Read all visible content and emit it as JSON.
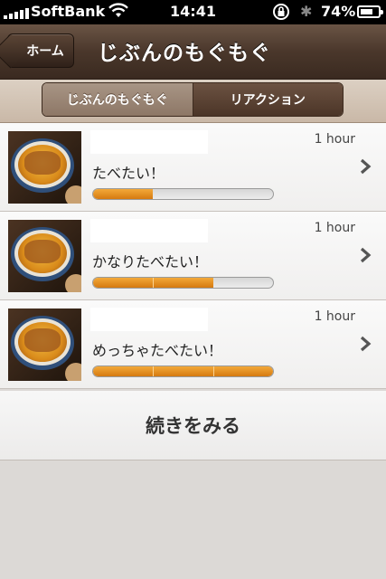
{
  "status_bar": {
    "carrier": "SoftBank",
    "time": "14:41",
    "battery": "74%",
    "battery_level": 0.74
  },
  "nav": {
    "back_label": "ホーム",
    "title": "じぶんのもぐもぐ"
  },
  "segments": [
    {
      "label": "じぶんのもぐもぐ",
      "selected": true
    },
    {
      "label": "リアクション",
      "selected": false
    }
  ],
  "items": [
    {
      "time_ago": "1 hour",
      "text": "たべたい！",
      "level": 1,
      "level_max": 3
    },
    {
      "time_ago": "1 hour",
      "text": "かなりたべたい！",
      "level": 2,
      "level_max": 3
    },
    {
      "time_ago": "1 hour",
      "text": "めっちゃたべたい！",
      "level": 3,
      "level_max": 3
    }
  ],
  "more_label": "続きをみる",
  "colors": {
    "accent": "#e08a1e",
    "nav": "#4a372b"
  }
}
